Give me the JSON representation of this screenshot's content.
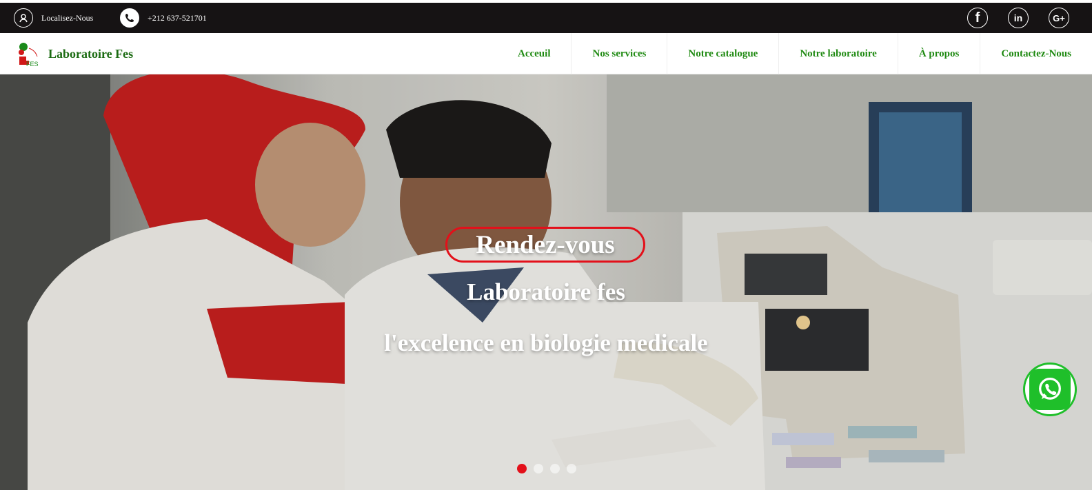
{
  "topbar": {
    "location_label": "Localisez-Nous",
    "phone": "+212 637-521701",
    "social_icons": [
      "facebook-icon",
      "linkedin-icon",
      "google-plus-icon"
    ],
    "linkedin_glyph": "in",
    "google_glyph": "G+",
    "facebook_glyph": "f"
  },
  "navbar": {
    "brand": "Laboratoire Fes",
    "logo_text": "FES",
    "items": [
      {
        "label": "Acceuil"
      },
      {
        "label": "Nos services"
      },
      {
        "label": "Notre catalogue"
      },
      {
        "label": "Notre laboratoire"
      },
      {
        "label": "À propos"
      },
      {
        "label": "Contactez-Nous"
      }
    ]
  },
  "hero": {
    "button_label": "Rendez-vous",
    "title": "Laboratoire fes",
    "subtitle": "l'excelence en biologie medicale",
    "slides_count": 4,
    "active_slide": 1
  },
  "colors": {
    "topbar_bg": "#161314",
    "nav_text": "#1f8a12",
    "accent_red": "#e3101a",
    "whatsapp_green": "#1fbf2a"
  }
}
